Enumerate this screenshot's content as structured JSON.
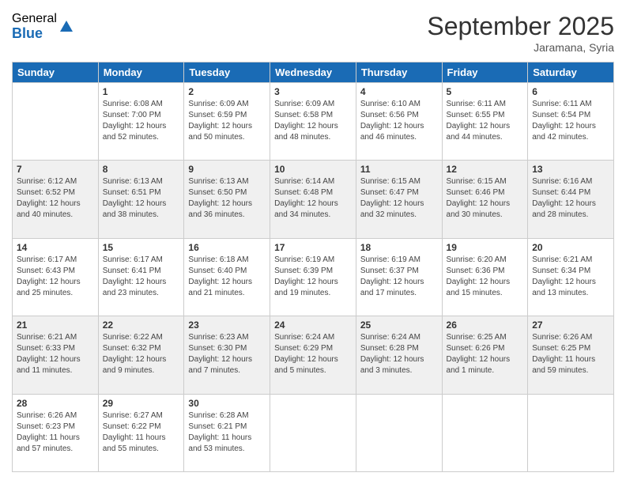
{
  "logo": {
    "general": "General",
    "blue": "Blue"
  },
  "title": "September 2025",
  "subtitle": "Jaramana, Syria",
  "days": [
    "Sunday",
    "Monday",
    "Tuesday",
    "Wednesday",
    "Thursday",
    "Friday",
    "Saturday"
  ],
  "weeks": [
    [
      {
        "day": "",
        "content": ""
      },
      {
        "day": "1",
        "content": "Sunrise: 6:08 AM\nSunset: 7:00 PM\nDaylight: 12 hours\nand 52 minutes."
      },
      {
        "day": "2",
        "content": "Sunrise: 6:09 AM\nSunset: 6:59 PM\nDaylight: 12 hours\nand 50 minutes."
      },
      {
        "day": "3",
        "content": "Sunrise: 6:09 AM\nSunset: 6:58 PM\nDaylight: 12 hours\nand 48 minutes."
      },
      {
        "day": "4",
        "content": "Sunrise: 6:10 AM\nSunset: 6:56 PM\nDaylight: 12 hours\nand 46 minutes."
      },
      {
        "day": "5",
        "content": "Sunrise: 6:11 AM\nSunset: 6:55 PM\nDaylight: 12 hours\nand 44 minutes."
      },
      {
        "day": "6",
        "content": "Sunrise: 6:11 AM\nSunset: 6:54 PM\nDaylight: 12 hours\nand 42 minutes."
      }
    ],
    [
      {
        "day": "7",
        "content": "Sunrise: 6:12 AM\nSunset: 6:52 PM\nDaylight: 12 hours\nand 40 minutes."
      },
      {
        "day": "8",
        "content": "Sunrise: 6:13 AM\nSunset: 6:51 PM\nDaylight: 12 hours\nand 38 minutes."
      },
      {
        "day": "9",
        "content": "Sunrise: 6:13 AM\nSunset: 6:50 PM\nDaylight: 12 hours\nand 36 minutes."
      },
      {
        "day": "10",
        "content": "Sunrise: 6:14 AM\nSunset: 6:48 PM\nDaylight: 12 hours\nand 34 minutes."
      },
      {
        "day": "11",
        "content": "Sunrise: 6:15 AM\nSunset: 6:47 PM\nDaylight: 12 hours\nand 32 minutes."
      },
      {
        "day": "12",
        "content": "Sunrise: 6:15 AM\nSunset: 6:46 PM\nDaylight: 12 hours\nand 30 minutes."
      },
      {
        "day": "13",
        "content": "Sunrise: 6:16 AM\nSunset: 6:44 PM\nDaylight: 12 hours\nand 28 minutes."
      }
    ],
    [
      {
        "day": "14",
        "content": "Sunrise: 6:17 AM\nSunset: 6:43 PM\nDaylight: 12 hours\nand 25 minutes."
      },
      {
        "day": "15",
        "content": "Sunrise: 6:17 AM\nSunset: 6:41 PM\nDaylight: 12 hours\nand 23 minutes."
      },
      {
        "day": "16",
        "content": "Sunrise: 6:18 AM\nSunset: 6:40 PM\nDaylight: 12 hours\nand 21 minutes."
      },
      {
        "day": "17",
        "content": "Sunrise: 6:19 AM\nSunset: 6:39 PM\nDaylight: 12 hours\nand 19 minutes."
      },
      {
        "day": "18",
        "content": "Sunrise: 6:19 AM\nSunset: 6:37 PM\nDaylight: 12 hours\nand 17 minutes."
      },
      {
        "day": "19",
        "content": "Sunrise: 6:20 AM\nSunset: 6:36 PM\nDaylight: 12 hours\nand 15 minutes."
      },
      {
        "day": "20",
        "content": "Sunrise: 6:21 AM\nSunset: 6:34 PM\nDaylight: 12 hours\nand 13 minutes."
      }
    ],
    [
      {
        "day": "21",
        "content": "Sunrise: 6:21 AM\nSunset: 6:33 PM\nDaylight: 12 hours\nand 11 minutes."
      },
      {
        "day": "22",
        "content": "Sunrise: 6:22 AM\nSunset: 6:32 PM\nDaylight: 12 hours\nand 9 minutes."
      },
      {
        "day": "23",
        "content": "Sunrise: 6:23 AM\nSunset: 6:30 PM\nDaylight: 12 hours\nand 7 minutes."
      },
      {
        "day": "24",
        "content": "Sunrise: 6:24 AM\nSunset: 6:29 PM\nDaylight: 12 hours\nand 5 minutes."
      },
      {
        "day": "25",
        "content": "Sunrise: 6:24 AM\nSunset: 6:28 PM\nDaylight: 12 hours\nand 3 minutes."
      },
      {
        "day": "26",
        "content": "Sunrise: 6:25 AM\nSunset: 6:26 PM\nDaylight: 12 hours\nand 1 minute."
      },
      {
        "day": "27",
        "content": "Sunrise: 6:26 AM\nSunset: 6:25 PM\nDaylight: 11 hours\nand 59 minutes."
      }
    ],
    [
      {
        "day": "28",
        "content": "Sunrise: 6:26 AM\nSunset: 6:23 PM\nDaylight: 11 hours\nand 57 minutes."
      },
      {
        "day": "29",
        "content": "Sunrise: 6:27 AM\nSunset: 6:22 PM\nDaylight: 11 hours\nand 55 minutes."
      },
      {
        "day": "30",
        "content": "Sunrise: 6:28 AM\nSunset: 6:21 PM\nDaylight: 11 hours\nand 53 minutes."
      },
      {
        "day": "",
        "content": ""
      },
      {
        "day": "",
        "content": ""
      },
      {
        "day": "",
        "content": ""
      },
      {
        "day": "",
        "content": ""
      }
    ]
  ]
}
